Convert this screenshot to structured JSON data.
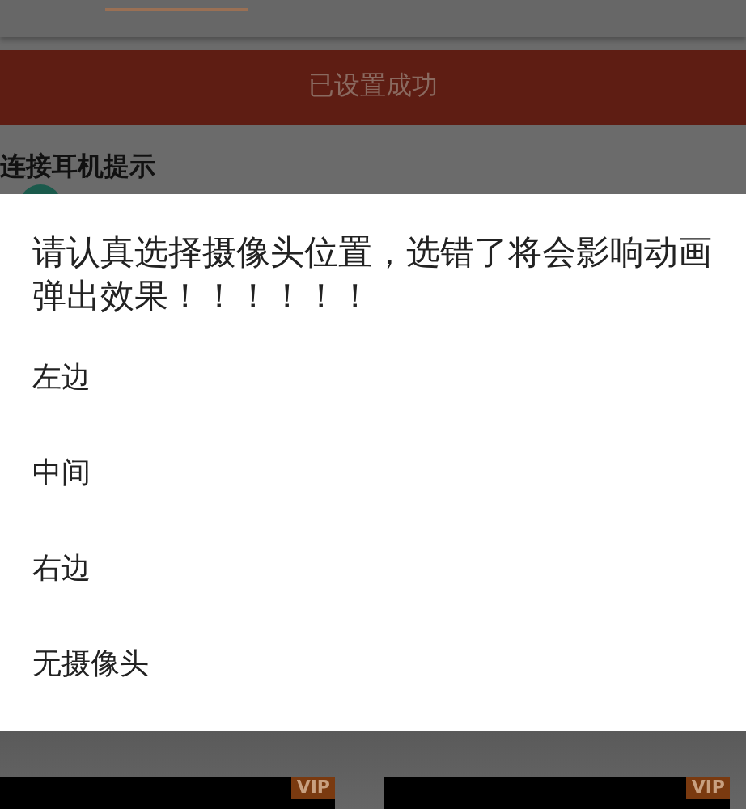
{
  "banner": {
    "text": "已设置成功"
  },
  "section": {
    "title": "连接耳机提示"
  },
  "dialog": {
    "message": "请认真选择摄像头位置，选错了将会影响动画弹出效果！！！！！！",
    "options": [
      {
        "label": "左边"
      },
      {
        "label": "中间"
      },
      {
        "label": "右边"
      },
      {
        "label": "无摄像头"
      }
    ]
  },
  "thumbnails": [
    {
      "badge": "VIP"
    },
    {
      "badge": "VIP"
    }
  ]
}
